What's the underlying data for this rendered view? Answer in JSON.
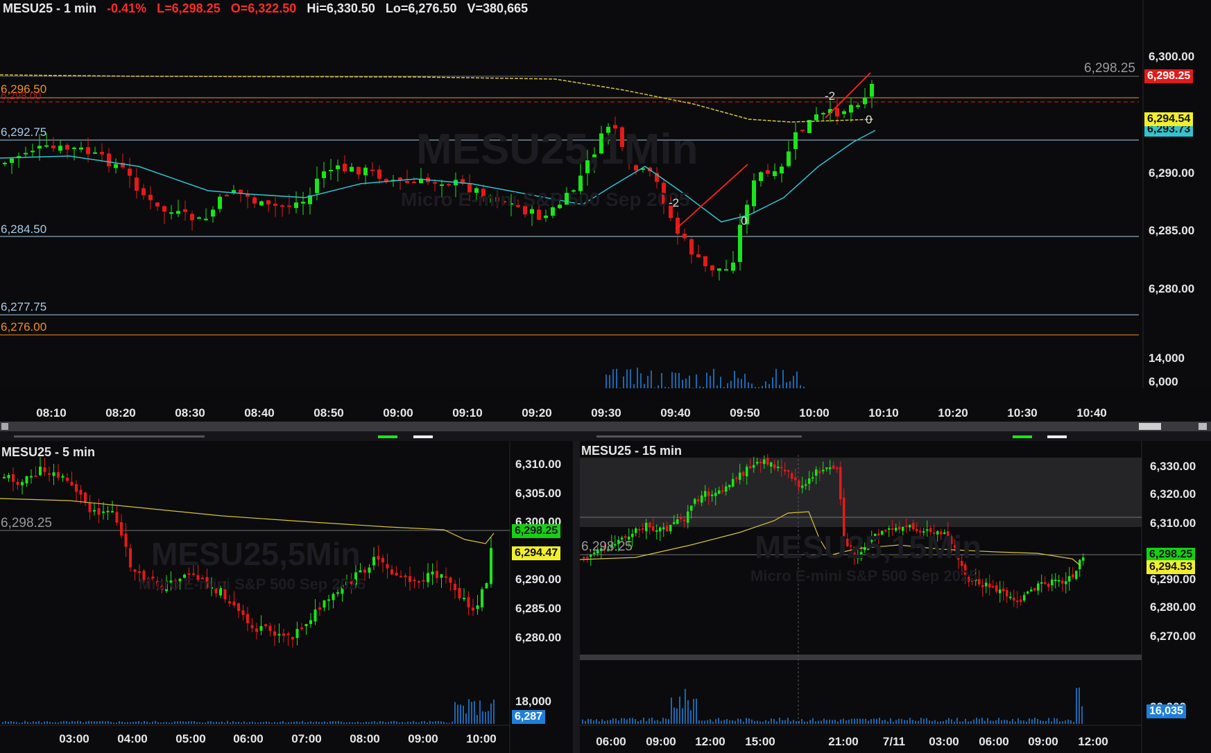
{
  "main": {
    "symbol_title": "MESU25 - 1 min",
    "pct_change": "-0.41%",
    "last": "L=6,298.25",
    "open": "O=6,322.50",
    "high": "Hi=6,330.50",
    "low": "Lo=6,276.50",
    "volume": "V=380,665",
    "watermark": "MESU25,1Min",
    "watermark_sub": "Micro E-mini S&P 500 Sep 2025",
    "level_labels": [
      "6,296.50",
      "6,298.00",
      "6,292.75",
      "6,284.50",
      "6,277.75",
      "6,276.00"
    ],
    "price_axis": [
      "6,300.00",
      "6,290.00",
      "6,285.00",
      "6,280.00"
    ],
    "volume_axis": [
      "14,000",
      "6,000"
    ],
    "time_axis": [
      "08:10",
      "08:20",
      "08:30",
      "08:40",
      "08:50",
      "09:00",
      "09:10",
      "09:20",
      "09:30",
      "09:40",
      "09:50",
      "10:00",
      "10:10",
      "10:20",
      "10:30",
      "10:40"
    ],
    "last_price_tag": "6,298.25",
    "last_price_grey": "6,298.25",
    "ma_tag_yellow": "6,294.54",
    "ma_tag_cyan": "6,293.73",
    "annotations": [
      "-2",
      "0",
      "-2",
      "0"
    ]
  },
  "bottom_left": {
    "title": "MESU25 - 5 min",
    "watermark": "MESU25,5Min",
    "watermark_sub": "Micro E-mini S&P 500 Sep 2025",
    "level_label": "6,298.25",
    "price_axis": [
      "6,310.00",
      "6,305.00",
      "6,300.00",
      "6,290.00",
      "6,285.00",
      "6,280.00"
    ],
    "volume_axis": "18,000",
    "volume_tag": "6,287",
    "last_price_tag": "6,298.25",
    "ma_tag": "6,294.47",
    "time_axis": [
      "03:00",
      "04:00",
      "05:00",
      "06:00",
      "07:00",
      "08:00",
      "09:00",
      "10:00"
    ]
  },
  "bottom_right": {
    "title": "MESU25 - 15 min",
    "watermark": "MESU25,15Min",
    "watermark_sub": "Micro E-mini S&P 500 Sep 2025",
    "level_label": "6,298.25",
    "price_axis": [
      "6,330.00",
      "6,320.00",
      "6,310.00",
      "6,290.00",
      "6,280.00",
      "6,270.00"
    ],
    "volume_axis": "20,000",
    "volume_tag": "16,035",
    "last_price_tag": "6,298.25",
    "ma_tag": "6,294.53",
    "time_axis": [
      "06:00",
      "09:00",
      "12:00",
      "15:00",
      "21:00",
      "7/11",
      "03:00",
      "06:00",
      "09:00",
      "12:00"
    ]
  },
  "colors": {
    "up": "#19e619",
    "down": "#e61919",
    "vwap": "#d8c53a",
    "ema": "#2fc4d0",
    "level_blue": "#a9cce8",
    "level_orange": "#f0901e",
    "price_tag_red": "#e01b1b",
    "price_tag_green": "#12d212",
    "ma_tag_yellow": "#f2ef2a",
    "vol_blue": "#1e7fd9"
  }
}
